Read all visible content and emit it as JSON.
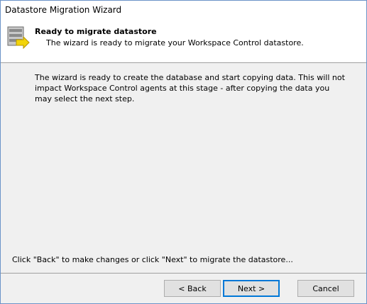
{
  "window": {
    "title": "Datastore Migration Wizard"
  },
  "header": {
    "icon": "database-icon",
    "heading": "Ready to migrate datastore",
    "subheading": "The wizard is ready to migrate your Workspace Control datastore."
  },
  "body": {
    "text": "The wizard is ready to create the database and start copying data. This will not impact Workspace Control agents at this stage - after copying the data you may select the next step."
  },
  "footer": {
    "hint": "Click \"Back\" to make changes or click \"Next\" to migrate the datastore..."
  },
  "buttons": {
    "back": "< Back",
    "next": "Next >",
    "cancel": "Cancel"
  }
}
